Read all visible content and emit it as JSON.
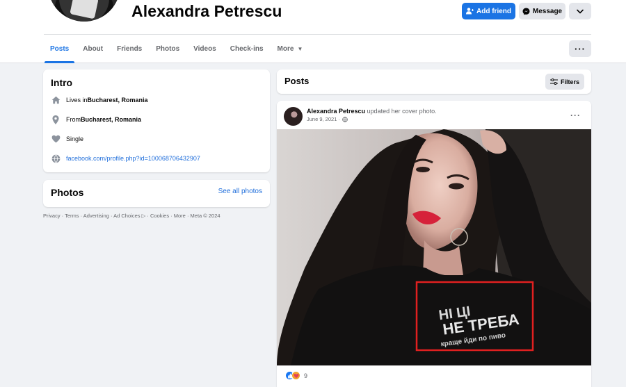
{
  "profile": {
    "name": "Alexandra Petrescu",
    "add_friend_label": "Add friend",
    "message_label": "Message"
  },
  "tabs": [
    {
      "label": "Posts",
      "active": true
    },
    {
      "label": "About"
    },
    {
      "label": "Friends"
    },
    {
      "label": "Photos"
    },
    {
      "label": "Videos"
    },
    {
      "label": "Check-ins"
    },
    {
      "label": "More"
    }
  ],
  "intro": {
    "title": "Intro",
    "lives_prefix": "Lives in ",
    "lives_place": "Bucharest, Romania",
    "from_prefix": "From ",
    "from_place": "Bucharest, Romania",
    "relationship": "Single",
    "profile_link": "facebook.com/profile.php?id=100068706432907"
  },
  "photos": {
    "title": "Photos",
    "see_all": "See all photos"
  },
  "footer": "Privacy · Terms · Advertising · Ad Choices ▷ · Cookies · More · Meta © 2024",
  "posts": {
    "title": "Posts",
    "filters_label": "Filters"
  },
  "post": {
    "author": "Alexandra Petrescu",
    "action": " updated her cover photo.",
    "date": "June 9, 2021 ·",
    "reaction_count": "9"
  },
  "icons": {
    "home": "home-icon",
    "location": "location-pin-icon",
    "heart": "heart-icon",
    "globe": "globe-icon",
    "filters": "filters-icon",
    "add_friend": "person-add-icon",
    "messenger": "messenger-icon"
  },
  "colors": {
    "accent": "#1b74e4",
    "link": "#216fdb",
    "annotation_box": "#e02020"
  }
}
